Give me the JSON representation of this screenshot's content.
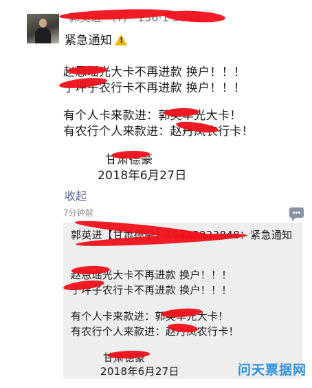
{
  "message": {
    "sender": "郭英进 （Y） 136·1 3848",
    "title": "紧急通知",
    "lines": [
      "赵恩瑶光大卡不再进款 换户！！！",
      "于坪子农行卡不再进款 换户！！！",
      "有个人卡来款进：郭英华光大卡！",
      "有农行个人来款进：赵丹凤农行卡！"
    ],
    "signature": "甘肃德豪",
    "date": "2018年6月27日"
  },
  "collapse_label": "收起",
  "timestamp": "7分钟前",
  "quoted": {
    "header": "郭英进【甘肃德豪】15313823848：紧急通知",
    "lines": [
      "赵恩瑶光大卡不再进款 换户！！！",
      "于坪子农行卡不再进款 换户！！！",
      "有个人卡来款进：郭英华光大卡！",
      "有农行个人来款进：赵丹凤农行卡！"
    ],
    "signature": "甘肃德豪",
    "date": "2018年6月27日"
  },
  "watermark": "问天票据网",
  "icons": {
    "title_icon": "warning-icon",
    "comment_icon": "chat-bubble-icon"
  },
  "colors": {
    "redaction": "#f0101a",
    "link": "#5b6b93",
    "quote_bg": "#eeeeee",
    "watermark": "#2f8fe0"
  }
}
